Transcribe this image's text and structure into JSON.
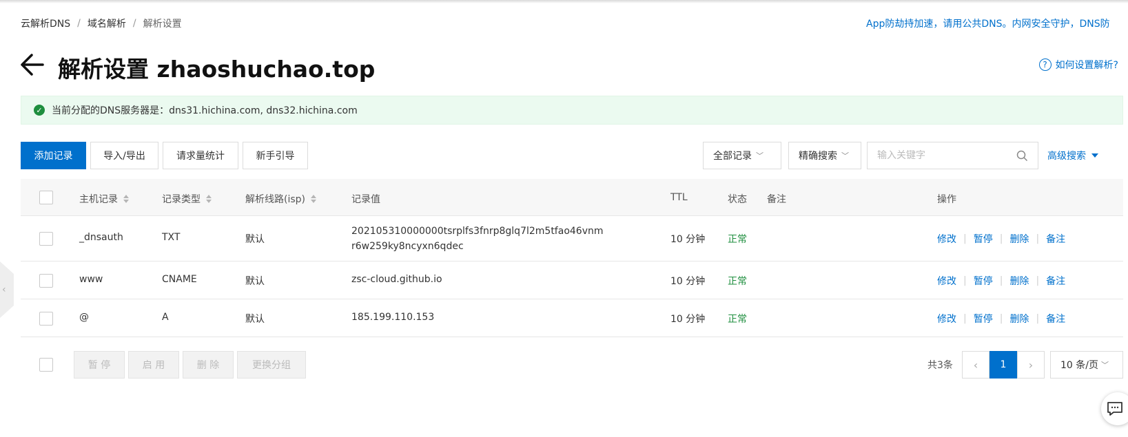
{
  "breadcrumb": [
    "云解析DNS",
    "域名解析",
    "解析设置"
  ],
  "notice": "App防劫持加速，请用公共DNS。内网安全守护，DNS防",
  "title": "解析设置 zhaoshuchao.top",
  "help_link": "如何设置解析?",
  "success_message": "当前分配的DNS服务器是：dns31.hichina.com, dns32.hichina.com",
  "toolbar": {
    "add": "添加记录",
    "import_export": "导入/导出",
    "stats": "请求量统计",
    "guide": "新手引导",
    "filter_all": "全部记录",
    "search_mode": "精确搜索",
    "search_placeholder": "输入关键字",
    "advanced": "高级搜索"
  },
  "columns": {
    "host": "主机记录",
    "type": "记录类型",
    "line": "解析线路(isp)",
    "value": "记录值",
    "ttl": "TTL",
    "status": "状态",
    "remark": "备注",
    "actions": "操作"
  },
  "rows": [
    {
      "host": "_dnsauth",
      "type": "TXT",
      "line": "默认",
      "value": "202105310000000tsrplfs3fnrp8glq7l2m5tfao46vnmr6w259ky8ncyxn6qdec",
      "ttl": "10 分钟",
      "status": "正常"
    },
    {
      "host": "www",
      "type": "CNAME",
      "line": "默认",
      "value": "zsc-cloud.github.io",
      "ttl": "10 分钟",
      "status": "正常"
    },
    {
      "host": "@",
      "type": "A",
      "line": "默认",
      "value": "185.199.110.153",
      "ttl": "10 分钟",
      "status": "正常"
    }
  ],
  "row_actions": [
    "修改",
    "暂停",
    "删除",
    "备注"
  ],
  "bulk_actions": [
    "暂 停",
    "启 用",
    "删 除",
    "更换分组"
  ],
  "pagination": {
    "total": "共3条",
    "current": "1",
    "page_size": "10 条/页"
  },
  "colors": {
    "primary": "#0070cc",
    "success": "#1e8e3e",
    "success_bg": "#ebfaf0"
  }
}
